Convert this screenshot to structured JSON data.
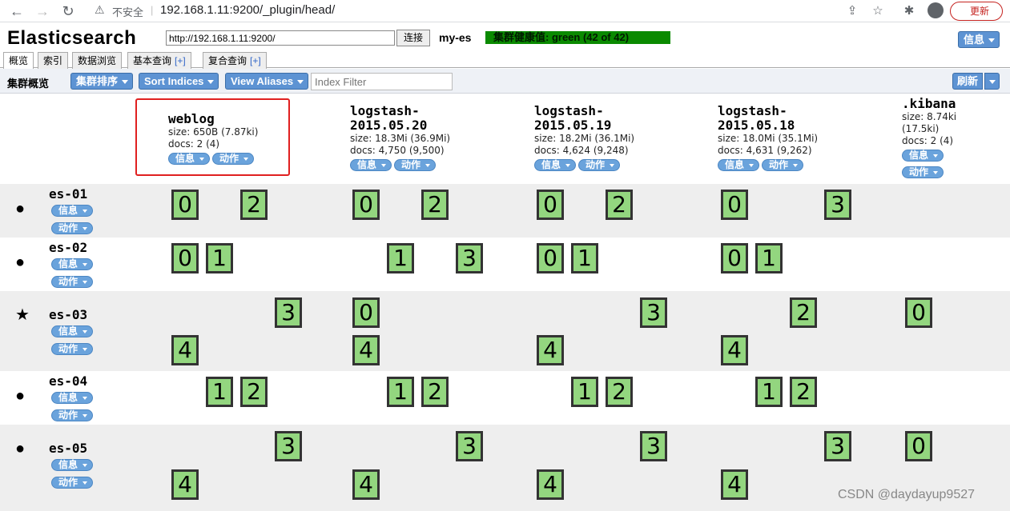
{
  "browser": {
    "insecure_label": "不安全",
    "url": "192.168.1.11:9200/_plugin/head/",
    "update_label": "更新"
  },
  "app": {
    "title": "Elasticsearch",
    "connect_url": "http://192.168.1.11:9200/",
    "connect_label": "连接",
    "cluster_name": "my-es",
    "health": "集群健康值: green (42 of 42)",
    "info_label": "信息"
  },
  "tabs": [
    {
      "label": "概览",
      "plus": ""
    },
    {
      "label": "索引",
      "plus": ""
    },
    {
      "label": "数据浏览",
      "plus": ""
    },
    {
      "label": "基本查询",
      "plus": "[+]"
    },
    {
      "label": "复合查询",
      "plus": "[+]"
    }
  ],
  "toolbar": {
    "label": "集群概览",
    "sort_cluster": "集群排序",
    "sort_indices": "Sort Indices",
    "view_aliases": "View Aliases",
    "filter_placeholder": "Index Filter",
    "refresh": "刷新"
  },
  "pill_labels": {
    "info": "信息",
    "action": "动作"
  },
  "indices": [
    {
      "name": "weblog",
      "size": "size: 650B (7.87ki)",
      "docs": "docs: 2 (4)"
    },
    {
      "name": "logstash-\n2015.05.20",
      "size": "size: 18.3Mi (36.9Mi)",
      "docs": "docs: 4,750 (9,500)"
    },
    {
      "name": "logstash-\n2015.05.19",
      "size": "size: 18.2Mi (36.1Mi)",
      "docs": "docs: 4,624 (9,248)"
    },
    {
      "name": "logstash-\n2015.05.18",
      "size": "size: 18.0Mi (35.1Mi)",
      "docs": "docs: 4,631 (9,262)"
    },
    {
      "name": ".kibana",
      "size": "size: 8.74ki",
      "docs": "(17.5ki)",
      "docs2": "docs: 2 (4)"
    }
  ],
  "nodes": [
    {
      "name": "es-01",
      "icon": "●",
      "master": false
    },
    {
      "name": "es-02",
      "icon": "●",
      "master": false
    },
    {
      "name": "es-03",
      "icon": "★",
      "master": true
    },
    {
      "name": "es-04",
      "icon": "●",
      "master": false
    },
    {
      "name": "es-05",
      "icon": "●",
      "master": false
    }
  ],
  "shards": {
    "es-01": [
      "0",
      "2",
      "0",
      "2",
      "0",
      "2",
      "0",
      "3"
    ],
    "es-02": [
      "0",
      "1",
      "1",
      "3",
      "0",
      "1",
      "0",
      "1"
    ],
    "es-03": [
      "3",
      "0",
      "3",
      "2",
      "0",
      "4",
      "4",
      "4",
      "4"
    ],
    "es-04": [
      "1",
      "2",
      "1",
      "2",
      "1",
      "2",
      "1",
      "2"
    ],
    "es-05": [
      "3",
      "3",
      "3",
      "3",
      "0",
      "4",
      "4",
      "4",
      "4"
    ]
  },
  "watermark": "CSDN @daydayup9527"
}
